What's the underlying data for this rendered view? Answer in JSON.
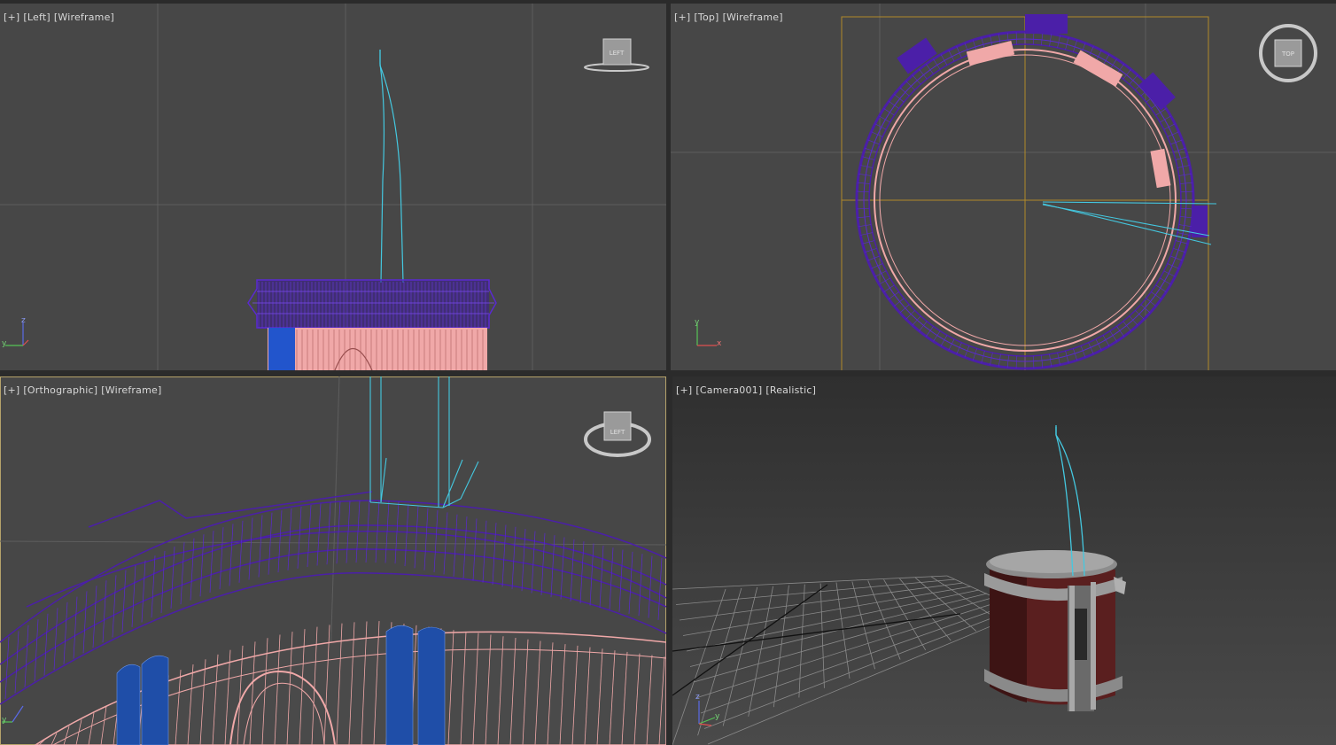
{
  "viewports": [
    {
      "menu": "[+]",
      "view": "[Left]",
      "shading": "[Wireframe]",
      "cube_label": "LEFT"
    },
    {
      "menu": "[+]",
      "view": "[Top]",
      "shading": "[Wireframe]",
      "cube_label": "TOP"
    },
    {
      "menu": "[+]",
      "view": "[Orthographic]",
      "shading": "[Wireframe]",
      "cube_label": "LEFT"
    },
    {
      "menu": "[+]",
      "view": "[Camera001]",
      "shading": "[Realistic]"
    }
  ],
  "axes": {
    "x": "x",
    "y": "y",
    "z": "z"
  },
  "colors": {
    "viewport_bg": "#474747",
    "grid": "#5c5c5c",
    "wire_purple": "#4b1fa8",
    "wire_pink": "#f0a8a8",
    "wire_cyan": "#44c8e0",
    "wire_blue": "#2255cc",
    "active_border": "#b5a26a"
  }
}
